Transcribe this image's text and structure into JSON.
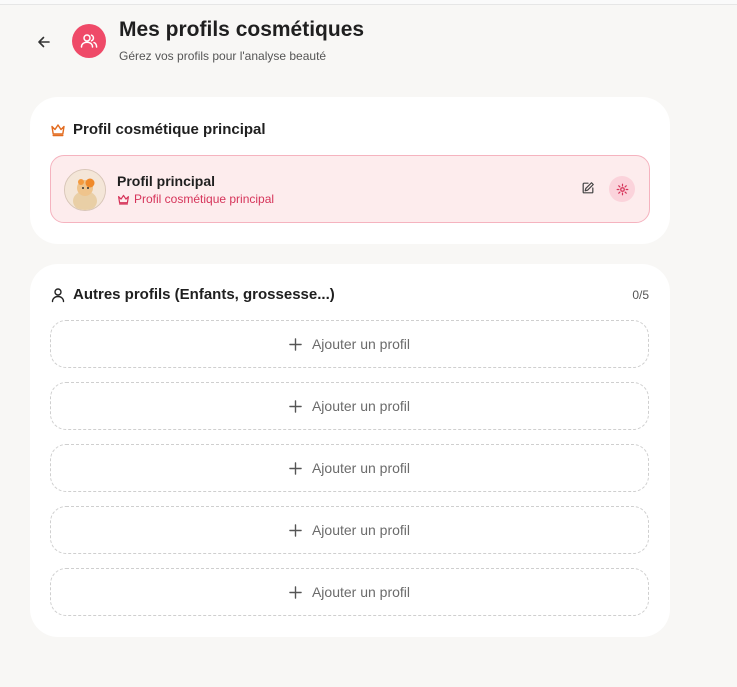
{
  "header": {
    "title": "Mes profils cosmétiques",
    "subtitle": "Gérez vos profils pour l'analyse beauté",
    "back_icon": "arrow-left-icon",
    "header_icon": "users-icon"
  },
  "main_profile_section": {
    "title": "Profil cosmétique principal",
    "title_icon": "crown-icon",
    "profile": {
      "name": "Profil principal",
      "badge_label": "Profil cosmétique principal",
      "badge_icon": "crown-icon",
      "avatar": "avatar-image",
      "edit_icon": "edit-icon",
      "settings_icon": "gear-icon"
    }
  },
  "other_profiles_section": {
    "title": "Autres profils (Enfants, grossesse...)",
    "title_icon": "user-icon",
    "count": "0/5",
    "slots": [
      {
        "label": "Ajouter un profil"
      },
      {
        "label": "Ajouter un profil"
      },
      {
        "label": "Ajouter un profil"
      },
      {
        "label": "Ajouter un profil"
      },
      {
        "label": "Ajouter un profil"
      }
    ]
  },
  "colors": {
    "accent": "#ef4a68",
    "accent_text": "#d6345a",
    "highlight_bg": "#fdeced",
    "highlight_border": "#f5b3bf",
    "crown": "#e26b1f",
    "background": "#f8f7f5"
  }
}
